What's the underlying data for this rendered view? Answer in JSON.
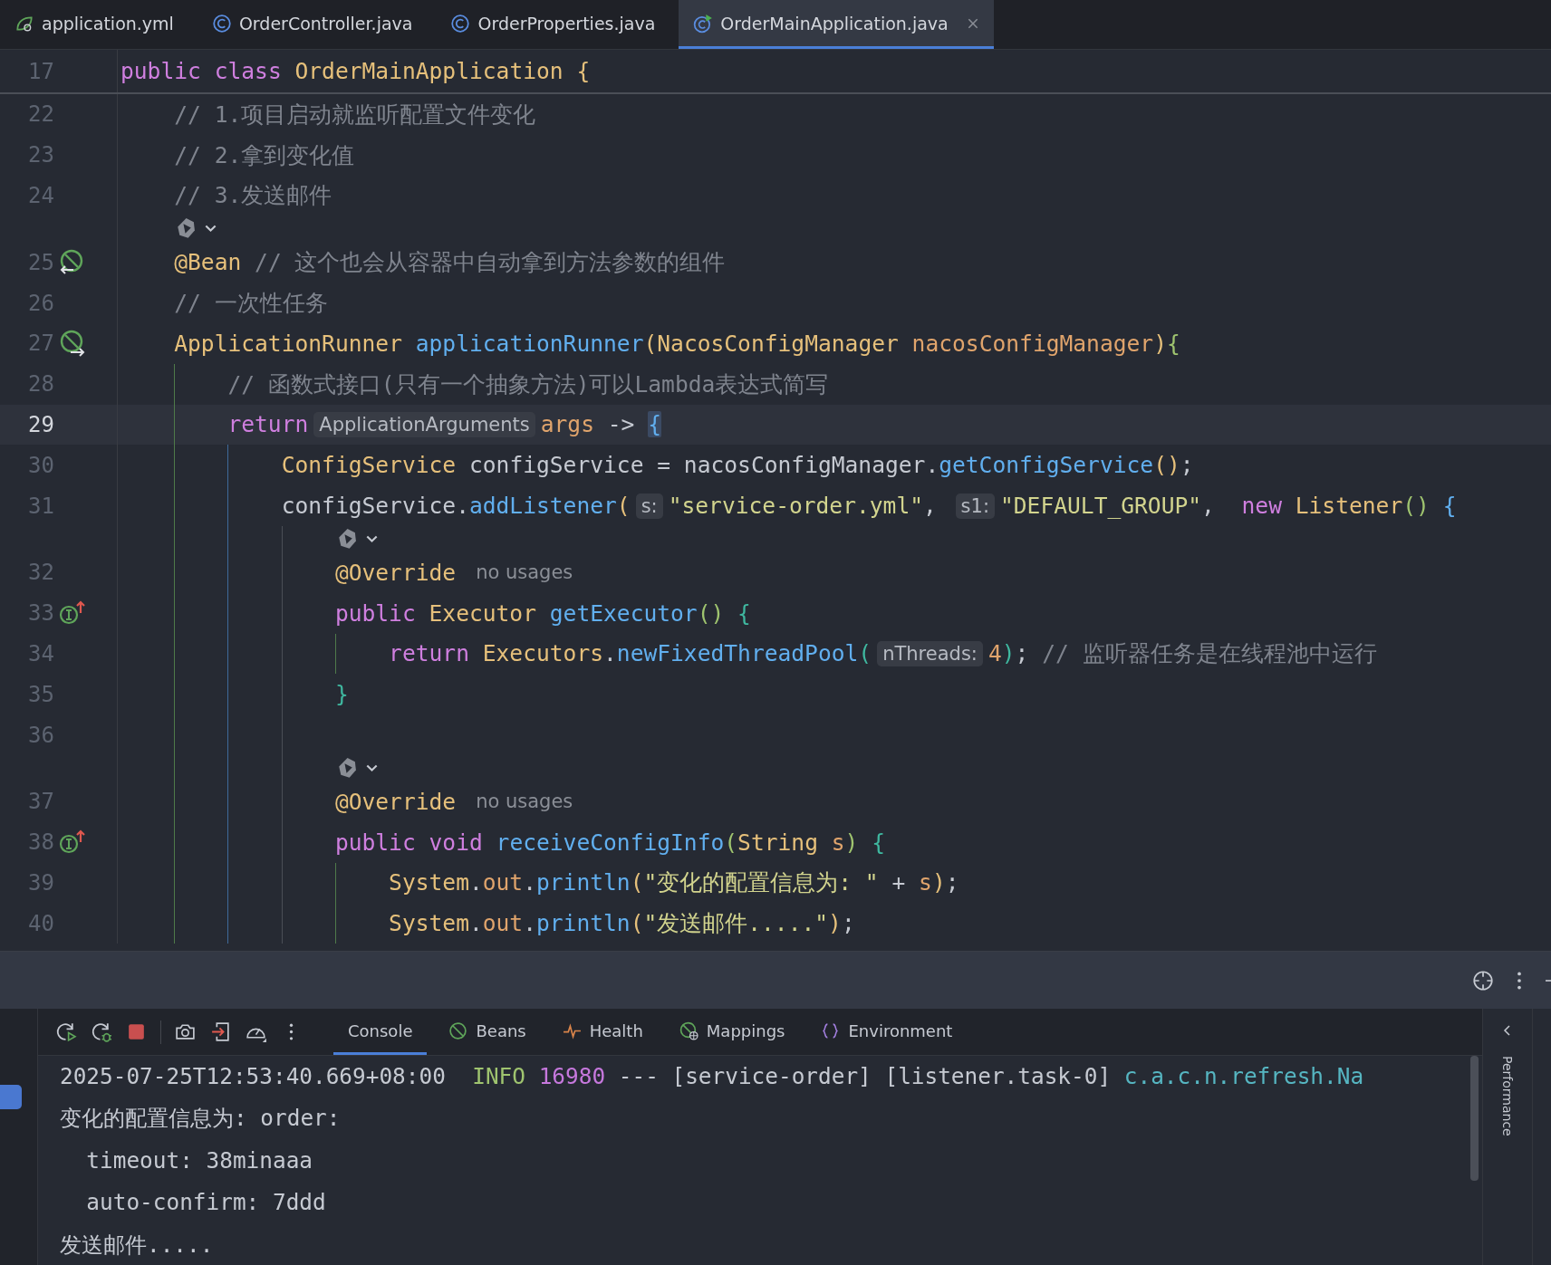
{
  "tabs": [
    {
      "label": "application.yml",
      "kind": "yaml",
      "selected": false
    },
    {
      "label": "OrderController.java",
      "kind": "class",
      "selected": false
    },
    {
      "label": "OrderProperties.java",
      "kind": "class",
      "selected": false
    },
    {
      "label": "OrderMainApplication.java",
      "kind": "main-class",
      "selected": true
    }
  ],
  "editor": {
    "sticky_line": {
      "number": "17",
      "tokens": [
        {
          "kind": "kw",
          "text": "public"
        },
        {
          "kind": "kw",
          "text": " class"
        },
        {
          "kind": "type",
          "text": " OrderMainApplication"
        },
        {
          "kind": "brace",
          "text": " {",
          "color": "#e6c07b"
        }
      ]
    },
    "lines": [
      {
        "kind": "code",
        "number": "22",
        "current": false,
        "tokens": [
          {
            "kind": "comment",
            "text": "    // 1.项目启动就监听配置文件变化"
          }
        ]
      },
      {
        "kind": "code",
        "number": "23",
        "current": false,
        "tokens": [
          {
            "kind": "comment",
            "text": "    // 2.拿到变化值"
          }
        ]
      },
      {
        "kind": "code",
        "number": "24",
        "current": false,
        "tokens": [
          {
            "kind": "comment",
            "text": "    // 3.发送邮件"
          }
        ]
      },
      {
        "kind": "assist"
      },
      {
        "kind": "code",
        "number": "25",
        "current": false,
        "gutter": {
          "kind": "bean-out"
        },
        "tokens": [
          {
            "kind": "annotation",
            "text": "    @Bean"
          },
          {
            "kind": "comment",
            "text": " // 这个也会从容器中自动拿到方法参数的组件"
          }
        ]
      },
      {
        "kind": "code",
        "number": "26",
        "current": false,
        "tokens": [
          {
            "kind": "comment",
            "text": "    // 一次性任务"
          }
        ]
      },
      {
        "kind": "code",
        "number": "27",
        "current": false,
        "gutter": {
          "kind": "bean-in"
        },
        "tokens": [
          {
            "kind": "type",
            "text": "    ApplicationRunner"
          },
          {
            "kind": "fn",
            "text": " applicationRunner"
          },
          {
            "kind": "brace",
            "text": "(",
            "color": "#e6c07b"
          },
          {
            "kind": "type",
            "text": "NacosConfigManager"
          },
          {
            "kind": "param",
            "text": " nacosConfigManager"
          },
          {
            "kind": "brace",
            "text": ")",
            "color": "#e6c07b"
          },
          {
            "kind": "brace",
            "text": "{",
            "color": "#9fc46f"
          }
        ]
      },
      {
        "kind": "code",
        "number": "28",
        "current": false,
        "tokens": [
          {
            "kind": "comment",
            "text": "        // 函数式接口(只有一个抽象方法)可以Lambda表达式简写"
          }
        ]
      },
      {
        "kind": "code",
        "number": "29",
        "current": true,
        "tokens": [
          {
            "kind": "kw",
            "text": "        return"
          },
          {
            "kind": "hint",
            "text": "ApplicationArguments"
          },
          {
            "kind": "param",
            "text": "args"
          },
          {
            "kind": "plain",
            "text": " ->"
          },
          {
            "kind": "brace-match",
            "text": "{"
          }
        ]
      },
      {
        "kind": "code",
        "number": "30",
        "current": false,
        "tokens": [
          {
            "kind": "type",
            "text": "            ConfigService"
          },
          {
            "kind": "plain",
            "text": " configService = nacosConfigManager."
          },
          {
            "kind": "fn",
            "text": "getConfigService"
          },
          {
            "kind": "brace",
            "text": "()",
            "color": "#e6c07b"
          },
          {
            "kind": "plain",
            "text": ";"
          }
        ]
      },
      {
        "kind": "code",
        "number": "31",
        "current": false,
        "tokens": [
          {
            "kind": "plain",
            "text": "            configService."
          },
          {
            "kind": "fn",
            "text": "addListener"
          },
          {
            "kind": "brace",
            "text": "(",
            "color": "#e6c07b"
          },
          {
            "kind": "hint",
            "text": "s:"
          },
          {
            "kind": "str",
            "text": "\"service-order.yml\""
          },
          {
            "kind": "comma",
            "text": ","
          },
          {
            "kind": "hint",
            "text": "s1:"
          },
          {
            "kind": "str",
            "text": "\"DEFAULT_GROUP\""
          },
          {
            "kind": "comma",
            "text": ","
          },
          {
            "kind": "kw",
            "text": " new"
          },
          {
            "kind": "type",
            "text": " Listener"
          },
          {
            "kind": "brace",
            "text": "()",
            "color": "#9fc46f"
          },
          {
            "kind": "brace",
            "text": " {",
            "color": "#61afef"
          }
        ]
      },
      {
        "kind": "assist"
      },
      {
        "kind": "code",
        "number": "32",
        "current": false,
        "tokens": [
          {
            "kind": "annotation",
            "text": "                @Override"
          },
          {
            "kind": "usage",
            "text": "no usages"
          }
        ]
      },
      {
        "kind": "code",
        "number": "33",
        "current": false,
        "gutter": {
          "kind": "implements"
        },
        "tokens": [
          {
            "kind": "kw",
            "text": "                public"
          },
          {
            "kind": "type",
            "text": " Executor"
          },
          {
            "kind": "fn",
            "text": " getExecutor"
          },
          {
            "kind": "brace",
            "text": "()",
            "color": "#9fc46f"
          },
          {
            "kind": "brace",
            "text": " {",
            "color": "#3fb8a0"
          }
        ]
      },
      {
        "kind": "code",
        "number": "34",
        "current": false,
        "tokens": [
          {
            "kind": "kw",
            "text": "                    return"
          },
          {
            "kind": "type",
            "text": " Executors"
          },
          {
            "kind": "plain",
            "text": "."
          },
          {
            "kind": "fn",
            "text": "newFixedThreadPool"
          },
          {
            "kind": "brace",
            "text": "(",
            "color": "#3fb8a0"
          },
          {
            "kind": "hint",
            "text": "nThreads:"
          },
          {
            "kind": "num",
            "text": "4"
          },
          {
            "kind": "brace",
            "text": ")",
            "color": "#3fb8a0"
          },
          {
            "kind": "plain",
            "text": ";"
          },
          {
            "kind": "comment",
            "text": " // 监听器任务是在线程池中运行"
          }
        ]
      },
      {
        "kind": "code",
        "number": "35",
        "current": false,
        "tokens": [
          {
            "kind": "brace",
            "text": "                }",
            "color": "#3fb8a0"
          }
        ]
      },
      {
        "kind": "code",
        "number": "36",
        "current": false
      },
      {
        "kind": "assist"
      },
      {
        "kind": "code",
        "number": "37",
        "current": false,
        "tokens": [
          {
            "kind": "annotation",
            "text": "                @Override"
          },
          {
            "kind": "usage",
            "text": "no usages"
          }
        ]
      },
      {
        "kind": "code",
        "number": "38",
        "current": false,
        "gutter": {
          "kind": "implements"
        },
        "tokens": [
          {
            "kind": "kw",
            "text": "                public"
          },
          {
            "kind": "kw",
            "text": " void"
          },
          {
            "kind": "fn",
            "text": " receiveConfigInfo"
          },
          {
            "kind": "brace",
            "text": "(",
            "color": "#9fc46f"
          },
          {
            "kind": "type",
            "text": "String"
          },
          {
            "kind": "param",
            "text": " s"
          },
          {
            "kind": "brace",
            "text": ")",
            "color": "#9fc46f"
          },
          {
            "kind": "brace",
            "text": " {",
            "color": "#3fb8a0"
          }
        ]
      },
      {
        "kind": "code",
        "number": "39",
        "current": false,
        "tokens": [
          {
            "kind": "type",
            "text": "                    System"
          },
          {
            "kind": "plain",
            "text": "."
          },
          {
            "kind": "field",
            "text": "out"
          },
          {
            "kind": "plain",
            "text": "."
          },
          {
            "kind": "fn",
            "text": "println"
          },
          {
            "kind": "brace",
            "text": "(",
            "color": "#e6c07b"
          },
          {
            "kind": "str",
            "text": "\"变化的配置信息为: \""
          },
          {
            "kind": "plain",
            "text": " +"
          },
          {
            "kind": "param",
            "text": " s"
          },
          {
            "kind": "brace",
            "text": ")",
            "color": "#e6c07b"
          },
          {
            "kind": "plain",
            "text": ";"
          }
        ]
      },
      {
        "kind": "code",
        "number": "40",
        "current": false,
        "tokens": [
          {
            "kind": "type",
            "text": "                    System"
          },
          {
            "kind": "plain",
            "text": "."
          },
          {
            "kind": "field",
            "text": "out"
          },
          {
            "kind": "plain",
            "text": "."
          },
          {
            "kind": "fn",
            "text": "println"
          },
          {
            "kind": "brace",
            "text": "(",
            "color": "#e6c07b"
          },
          {
            "kind": "str",
            "text": "\"发送邮件.....\""
          },
          {
            "kind": "brace",
            "text": ")",
            "color": "#e6c07b"
          },
          {
            "kind": "plain",
            "text": ";"
          }
        ]
      }
    ]
  },
  "run_panel": {
    "tabs": [
      {
        "label": "Console",
        "kind": "console",
        "selected": true
      },
      {
        "label": "Beans",
        "kind": "beans",
        "selected": false
      },
      {
        "label": "Health",
        "kind": "health",
        "selected": false
      },
      {
        "label": "Mappings",
        "kind": "mappings",
        "selected": false
      },
      {
        "label": "Environment",
        "kind": "environment",
        "selected": false
      }
    ],
    "console_lines": [
      [
        {
          "kind": "plain",
          "text": "2025-07-25T12:53:40.669+08:00"
        },
        {
          "kind": "level",
          "text": "  INFO"
        },
        {
          "kind": "pid",
          "text": " 16980"
        },
        {
          "kind": "plain",
          "text": " --- [service-order] [listener.task-0]"
        },
        {
          "kind": "logger",
          "text": " c.a.c.n.refresh.Na"
        }
      ],
      [
        {
          "kind": "plain",
          "text": "变化的配置信息为: order:"
        }
      ],
      [
        {
          "kind": "plain",
          "text": "  timeout: 38minaaa"
        }
      ],
      [
        {
          "kind": "plain",
          "text": "  auto-confirm: 7ddd"
        }
      ],
      [
        {
          "kind": "plain",
          "text": "发送邮件....."
        }
      ]
    ],
    "side_label": "Performance"
  }
}
